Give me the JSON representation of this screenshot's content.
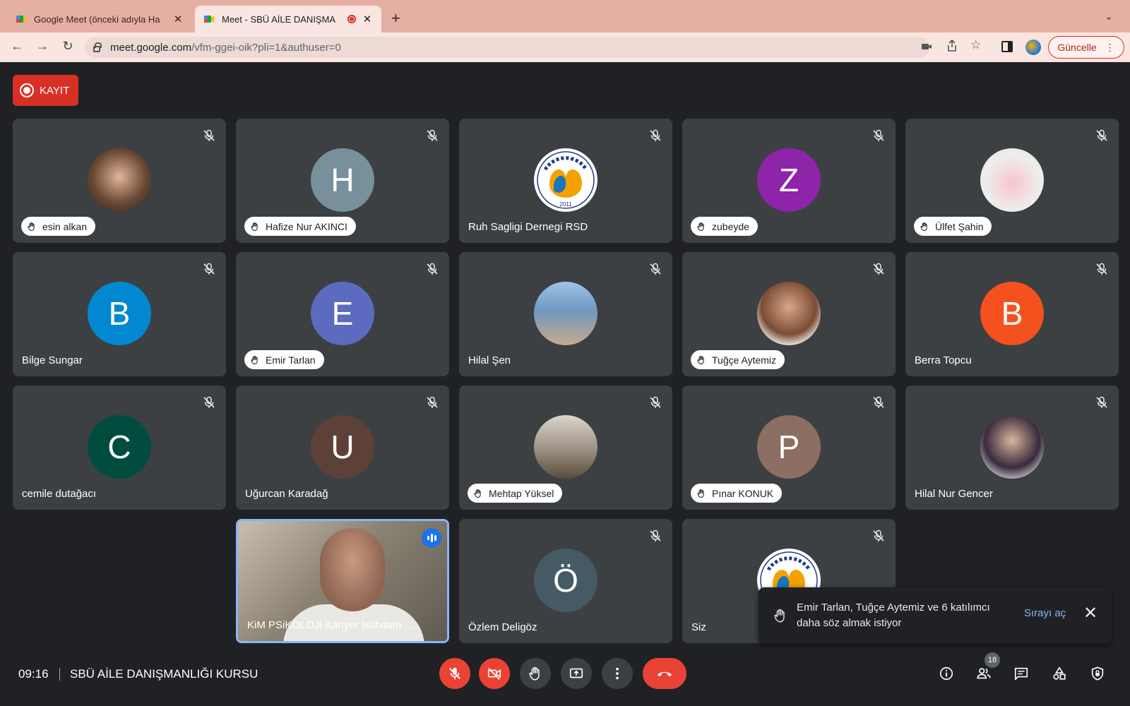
{
  "browser": {
    "tabs": [
      {
        "title": "Google Meet (önceki adıyla Ha",
        "active": false
      },
      {
        "title": "Meet - SBÜ AİLE DANIŞMA",
        "active": true,
        "recording": true
      }
    ],
    "url_host": "meet.google.com",
    "url_path": "/vfm-ggei-oik?pli=1&authuser=0",
    "update_label": "Güncelle"
  },
  "recording_label": "KAYIT",
  "participants": [
    {
      "name": "esin alkan",
      "hand": true
    },
    {
      "name": "Hafize Nur AKINCI",
      "hand": true,
      "initial": "H",
      "color": "#78909c"
    },
    {
      "name": "Ruh Sagligi Dernegi RSD",
      "hand": false,
      "logo_text": "RUH SAĞLIĞI DERNEĞİ",
      "logo_year": "2011"
    },
    {
      "name": "zubeyde",
      "hand": true,
      "initial": "Z",
      "color": "#8e24aa"
    },
    {
      "name": "Ülfet Şahin",
      "hand": true
    },
    {
      "name": "Bilge Sungar",
      "hand": false,
      "initial": "B",
      "color": "#0288d1"
    },
    {
      "name": "Emir Tarlan",
      "hand": true,
      "initial": "E",
      "color": "#5c6bc0"
    },
    {
      "name": "Hilal Şen",
      "hand": false
    },
    {
      "name": "Tuğçe Aytemiz",
      "hand": true
    },
    {
      "name": "Berra Topcu",
      "hand": false,
      "initial": "B",
      "color": "#f4511e"
    },
    {
      "name": "cemile dutağacı",
      "hand": false,
      "initial": "C",
      "color": "#004d40"
    },
    {
      "name": "Uğurcan Karadağ",
      "hand": false,
      "initial": "U",
      "color": "#5d4037"
    },
    {
      "name": "Mehtap Yüksel",
      "hand": true
    },
    {
      "name": "Pınar KONUK",
      "hand": true,
      "initial": "P",
      "color": "#8d6e63"
    },
    {
      "name": "Hilal Nur Gencer",
      "hand": false
    },
    {
      "name": "KiM PSiKOLOJi Kariyer İstihdam ...",
      "hand": false,
      "speaking": true
    },
    {
      "name": "Özlem Deligöz",
      "hand": false,
      "initial": "Ö",
      "color": "#455a64"
    },
    {
      "name": "Siz",
      "hand": false
    }
  ],
  "notification": {
    "message": "Emir Tarlan, Tuğçe Aytemiz ve 6 katılımcı daha söz almak istiyor",
    "action": "Sırayı aç"
  },
  "bottom_bar": {
    "time": "09:16",
    "meeting_title": "SBÜ AİLE DANIŞMANLIĞI KURSU",
    "participant_count": "18"
  },
  "colors": {
    "accent": "#8ab4f8",
    "danger": "#ea4335",
    "background": "#202124",
    "tile": "#3c4043"
  }
}
